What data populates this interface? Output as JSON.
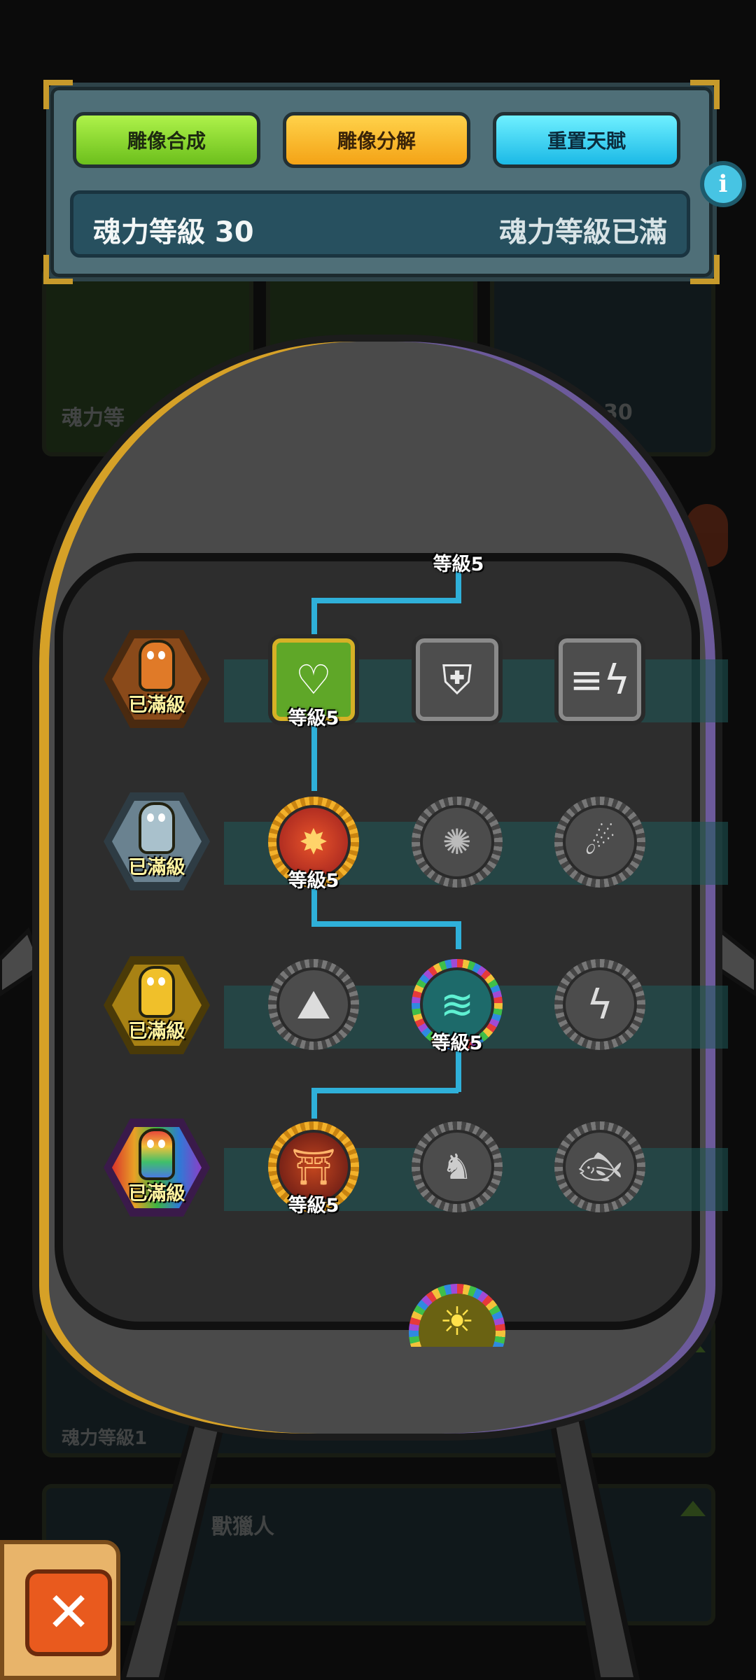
{
  "toolbar": {
    "statue_combine": "雕像合成",
    "statue_decompose": "雕像分解",
    "reset_talent": "重置天賦"
  },
  "soul": {
    "level_text": "魂力等級 30",
    "status_text": "魂力等級已滿"
  },
  "background": {
    "text_1": "魂力等",
    "text_2": "30",
    "text_3": "魂力等級1",
    "text_4": "獸獵人"
  },
  "rows": [
    {
      "statue_label": "已滿級",
      "statue_color": "#c4651c"
    },
    {
      "statue_label": "已滿級",
      "statue_color": "#8fa6b2"
    },
    {
      "statue_label": "已滿級",
      "statue_color": "#d2a51c"
    },
    {
      "statue_label": "已滿級",
      "statue_color": "#8a4fc6"
    }
  ],
  "nodes": {
    "top_partial_level": "等級5",
    "heart_level": "等級5",
    "fire_level": "等級5",
    "wave_level": "等級5",
    "tower_level": "等級5"
  },
  "colors": {
    "accent_path": "#2fb0d9",
    "green_button": "#8ed934",
    "orange_button": "#f7b624",
    "cyan_button": "#2cc9ee",
    "close_button": "#e95a1e"
  }
}
